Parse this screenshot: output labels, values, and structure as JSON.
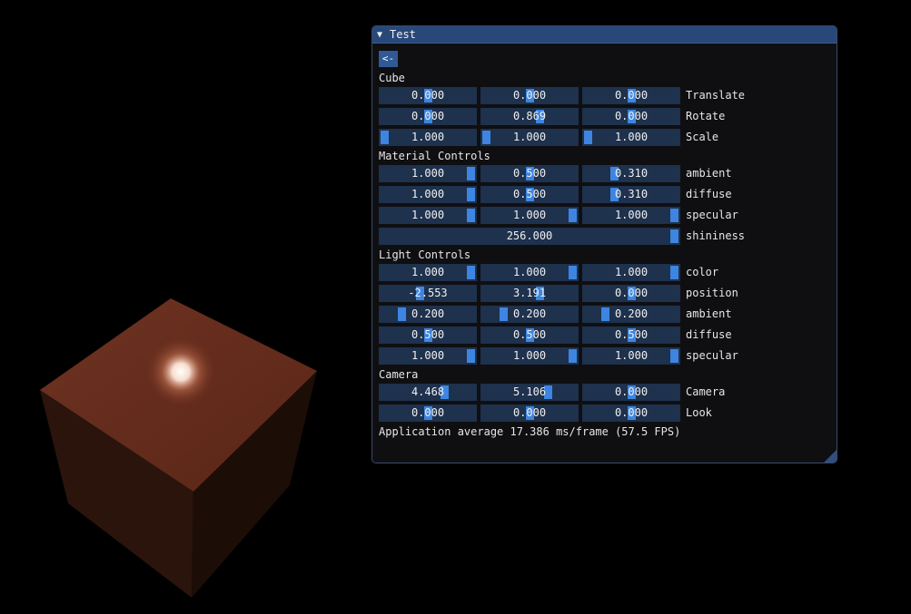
{
  "window": {
    "title": "Test",
    "back_label": "<-"
  },
  "sections": {
    "cube": "Cube",
    "material": "Material Controls",
    "light": "Light Controls",
    "camera": "Camera"
  },
  "rows": [
    {
      "section": "cube",
      "label": "Translate",
      "values": [
        "0.000",
        "0.000",
        "0.000"
      ],
      "slider_fraction": [
        0.5,
        0.5,
        0.5
      ]
    },
    {
      "section": "cube",
      "label": "Rotate",
      "values": [
        "0.000",
        "0.869",
        "0.000"
      ],
      "slider_fraction": [
        0.5,
        0.62,
        0.5
      ]
    },
    {
      "section": "cube",
      "label": "Scale",
      "values": [
        "1.000",
        "1.000",
        "1.000"
      ],
      "slider_fraction": [
        0.0,
        0.0,
        0.0
      ]
    },
    {
      "section": "material",
      "label": "ambient",
      "values": [
        "1.000",
        "0.500",
        "0.310"
      ],
      "slider_fraction": [
        1.0,
        0.5,
        0.31
      ]
    },
    {
      "section": "material",
      "label": "diffuse",
      "values": [
        "1.000",
        "0.500",
        "0.310"
      ],
      "slider_fraction": [
        1.0,
        0.5,
        0.31
      ]
    },
    {
      "section": "material",
      "label": "specular",
      "values": [
        "1.000",
        "1.000",
        "1.000"
      ],
      "slider_fraction": [
        1.0,
        1.0,
        1.0
      ]
    },
    {
      "section": "material",
      "label": "shininess",
      "values": [
        "256.000"
      ],
      "slider_fraction": [
        1.0
      ]
    },
    {
      "section": "light",
      "label": "color",
      "values": [
        "1.000",
        "1.000",
        "1.000"
      ],
      "slider_fraction": [
        1.0,
        1.0,
        1.0
      ]
    },
    {
      "section": "light",
      "label": "position",
      "values": [
        "-2.553",
        "3.191",
        "0.000"
      ],
      "slider_fraction": [
        0.41,
        0.62,
        0.5
      ]
    },
    {
      "section": "light",
      "label": "ambient",
      "values": [
        "0.200",
        "0.200",
        "0.200"
      ],
      "slider_fraction": [
        0.2,
        0.2,
        0.2
      ]
    },
    {
      "section": "light",
      "label": "diffuse",
      "values": [
        "0.500",
        "0.500",
        "0.500"
      ],
      "slider_fraction": [
        0.5,
        0.5,
        0.5
      ]
    },
    {
      "section": "light",
      "label": "specular",
      "values": [
        "1.000",
        "1.000",
        "1.000"
      ],
      "slider_fraction": [
        1.0,
        1.0,
        1.0
      ]
    },
    {
      "section": "camera",
      "label": "Camera",
      "values": [
        "4.468",
        "5.106",
        "0.000"
      ],
      "slider_fraction": [
        0.69,
        0.72,
        0.5
      ]
    },
    {
      "section": "camera",
      "label": "Look",
      "values": [
        "0.000",
        "0.000",
        "0.000"
      ],
      "slider_fraction": [
        0.5,
        0.5,
        0.5
      ]
    }
  ],
  "status": {
    "fps_text": "Application average 17.386 ms/frame (57.5 FPS)"
  },
  "colors": {
    "frame_bg": "#1e314d",
    "grab": "#3d85e0",
    "title_bg": "#29487a",
    "cube_top": "#6b3020",
    "cube_light": "#ffffff"
  }
}
